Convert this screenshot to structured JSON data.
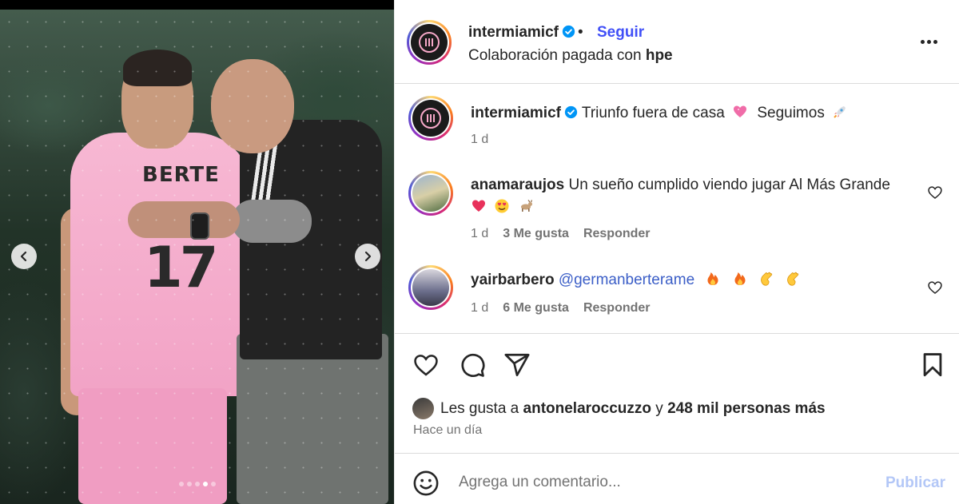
{
  "post": {
    "username": "intermiamicf",
    "separator": "•",
    "follow_label": "Seguir",
    "partnership_prefix": "Colaboración pagada con",
    "partnership_brand": "hpe",
    "options_icon": "more-horizontal-icon"
  },
  "photo": {
    "jersey_name": "BERTE",
    "jersey_number": "17",
    "carousel_dots": 5,
    "active_dot_index": 3,
    "prev_icon": "chevron-left-icon",
    "next_icon": "chevron-right-icon"
  },
  "caption": {
    "username": "intermiamicf",
    "text_1": "Triunfo fuera de casa",
    "text_2": "Seguimos",
    "emojis": [
      "pink-heart-emoji",
      "rocket-emoji"
    ],
    "time": "1 d"
  },
  "comments": [
    {
      "username": "anamaraujos",
      "text": "Un sueño cumplido viendo jugar Al Más Grande",
      "emojis": [
        "heart-emoji",
        "heart-eyes-emoji",
        "goat-emoji"
      ],
      "time": "1 d",
      "likes": "3 Me gusta",
      "reply_label": "Responder"
    },
    {
      "username": "yairbarbero",
      "mention": "@germanberterame",
      "emojis": [
        "fire-emoji",
        "fire-emoji",
        "clap-emoji",
        "clap-emoji"
      ],
      "time": "1 d",
      "likes": "6 Me gusta",
      "reply_label": "Responder"
    }
  ],
  "likes_summary": {
    "prefix": "Les gusta a",
    "user": "antonelaroccuzzo",
    "joiner": "y",
    "others": "248 mil personas más"
  },
  "posted_ago": "Hace un día",
  "composer": {
    "placeholder": "Agrega un comentario...",
    "publish_label": "Publicar"
  },
  "colors": {
    "accent_link": "#4150f7",
    "mention": "#3b5ec7",
    "publish_disabled": "#b3c7f7",
    "jersey_pink": "#f7b8d3"
  }
}
